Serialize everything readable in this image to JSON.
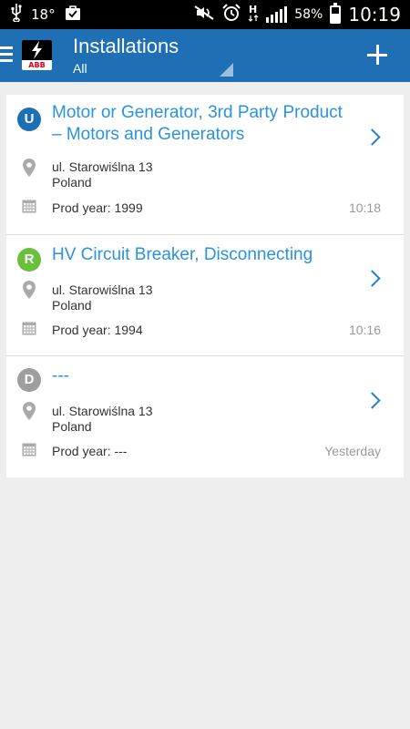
{
  "status_bar": {
    "temperature": "18°",
    "battery_percent": "58%",
    "battery_level": 0.58,
    "network": "H",
    "time": "10:19",
    "icons": [
      "usb-icon",
      "weather-icon",
      "bag-icon",
      "mute-icon",
      "alarm-icon",
      "network-h-icon",
      "signal-icon",
      "battery-charging-icon"
    ]
  },
  "app_bar": {
    "title": "Installations",
    "subtitle": "All",
    "logo_text": "ABB",
    "icons": [
      "menu-icon",
      "abb-logo",
      "dropdown-icon",
      "add-icon"
    ]
  },
  "accent_colors": {
    "app_bar": "#1f6fb4",
    "link": "#2a93dc",
    "badge_u": "#1f6fb4",
    "badge_r": "#6abf3c",
    "badge_d": "#9e9e9e"
  },
  "installations": [
    {
      "badge": "U",
      "badge_color": "#1f6fb4",
      "title": "Motor or Generator, 3rd Party Product – Motors and Generators",
      "address_line1": "ul. Starowiślna 13",
      "address_line2": "Poland",
      "prod_year": "Prod year: 1999",
      "time": "10:18"
    },
    {
      "badge": "R",
      "badge_color": "#6abf3c",
      "title": "HV Circuit Breaker, Disconnecting",
      "address_line1": "ul. Starowiślna 13",
      "address_line2": "Poland",
      "prod_year": "Prod year: 1994",
      "time": "10:16"
    },
    {
      "badge": "D",
      "badge_color": "#9e9e9e",
      "title": "---",
      "address_line1": "ul. Starowiślna 13",
      "address_line2": "Poland",
      "prod_year": "Prod year: ---",
      "time": "Yesterday"
    }
  ]
}
